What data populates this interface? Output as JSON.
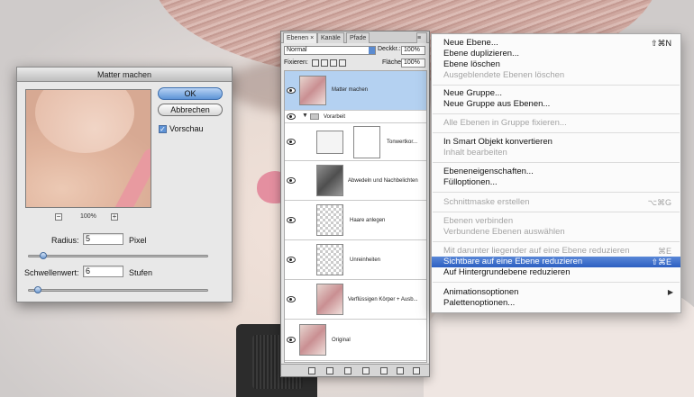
{
  "dialog": {
    "title": "Matter machen",
    "ok_label": "OK",
    "cancel_label": "Abbrechen",
    "preview_label": "Vorschau",
    "preview_checked": true,
    "zoom": "100%",
    "zoom_out": "−",
    "zoom_in": "+",
    "radius_label": "Radius:",
    "radius_value": "5",
    "radius_unit": "Pixel",
    "radius_slider": 0.06,
    "threshold_label": "Schwellenwert:",
    "threshold_value": "6",
    "threshold_unit": "Stufen",
    "threshold_slider": 0.03
  },
  "panel": {
    "tabs": [
      "Ebenen ×",
      "Kanäle",
      "Pfade"
    ],
    "blend_mode": "Normal",
    "opacity_label": "Deckkr.:",
    "opacity_value": "100%",
    "lock_label": "Fixieren:",
    "fill_label": "Fläche:",
    "fill_value": "100%",
    "layers": [
      {
        "name": "Matter machen",
        "selected": true
      },
      {
        "name": "Vorarbeit",
        "group": true
      },
      {
        "name": "Tonwertkor..."
      },
      {
        "name": "Abwedeln und Nachbelichten"
      },
      {
        "name": "Haare anlegen"
      },
      {
        "name": "Unreinheiten"
      },
      {
        "name": "Verflüssigen Körper + Ausb..."
      },
      {
        "name": "Original"
      }
    ]
  },
  "menu": {
    "items": [
      {
        "label": "Neue Ebene...",
        "shortcut": "⇧⌘N",
        "disabled": false
      },
      {
        "label": "Ebene duplizieren...",
        "shortcut": "",
        "disabled": false
      },
      {
        "label": "Ebene löschen",
        "shortcut": "",
        "disabled": false
      },
      {
        "label": "Ausgeblendete Ebenen löschen",
        "shortcut": "",
        "disabled": true
      },
      {
        "label": "Neue Gruppe...",
        "shortcut": "",
        "disabled": false
      },
      {
        "label": "Neue Gruppe aus Ebenen...",
        "shortcut": "",
        "disabled": false
      },
      {
        "label": "Alle Ebenen in Gruppe fixieren...",
        "shortcut": "",
        "disabled": true
      },
      {
        "label": "In Smart Objekt konvertieren",
        "shortcut": "",
        "disabled": false
      },
      {
        "label": "Inhalt bearbeiten",
        "shortcut": "",
        "disabled": true
      },
      {
        "label": "Ebeneneigenschaften...",
        "shortcut": "",
        "disabled": false
      },
      {
        "label": "Fülloptionen...",
        "shortcut": "",
        "disabled": false
      },
      {
        "label": "Schnittmaske erstellen",
        "shortcut": "⌥⌘G",
        "disabled": true
      },
      {
        "label": "Ebenen verbinden",
        "shortcut": "",
        "disabled": true
      },
      {
        "label": "Verbundene Ebenen auswählen",
        "shortcut": "",
        "disabled": true
      },
      {
        "label": "Mit darunter liegender auf eine Ebene reduzieren",
        "shortcut": "⌘E",
        "disabled": true
      },
      {
        "label": "Sichtbare auf eine Ebene reduzieren",
        "shortcut": "⇧⌘E",
        "disabled": false,
        "highlighted": true
      },
      {
        "label": "Auf Hintergrundebene reduzieren",
        "shortcut": "",
        "disabled": false
      },
      {
        "label": "Animationsoptionen",
        "shortcut": "▶",
        "disabled": false
      },
      {
        "label": "Palettenoptionen...",
        "shortcut": "",
        "disabled": false
      }
    ]
  }
}
